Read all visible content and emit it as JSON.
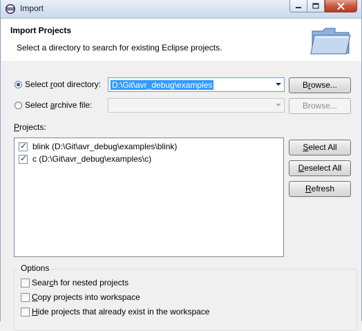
{
  "window": {
    "title": "Import",
    "buttons": {
      "minimize": "minimize",
      "maximize": "maximize",
      "close": "close"
    }
  },
  "header": {
    "title": "Import Projects",
    "description": "Select a directory to search for existing Eclipse projects."
  },
  "root_directory": {
    "label_pre": "Select ",
    "label_accel": "r",
    "label_post": "oot directory:",
    "selected": true,
    "value": "D:\\Git\\avr_debug\\examples",
    "browse_pre": "B",
    "browse_accel": "r",
    "browse_post": "owse..."
  },
  "archive_file": {
    "label_pre": "Select ",
    "label_accel": "a",
    "label_post": "rchive file:",
    "selected": false,
    "value": "",
    "browse_label": "Browse..."
  },
  "projects": {
    "label_accel": "P",
    "label_post": "rojects:",
    "items": [
      {
        "label": "blink (D:\\Git\\avr_debug\\examples\\blink)",
        "checked": true
      },
      {
        "label": "c (D:\\Git\\avr_debug\\examples\\c)",
        "checked": true
      }
    ],
    "buttons": {
      "select_all_pre": "",
      "select_all_accel": "S",
      "select_all_post": "elect All",
      "deselect_all_accel": "D",
      "deselect_all_post": "eselect All",
      "refresh_accel": "R",
      "refresh_post": "efresh"
    }
  },
  "options": {
    "title": "Options",
    "items": [
      {
        "pre": "Sear",
        "accel": "c",
        "post": "h for nested projects",
        "checked": false
      },
      {
        "pre": "",
        "accel": "C",
        "post": "opy projects into workspace",
        "checked": false
      },
      {
        "pre": "",
        "accel": "H",
        "post": "ide projects that already exist in the workspace",
        "checked": false
      }
    ]
  }
}
